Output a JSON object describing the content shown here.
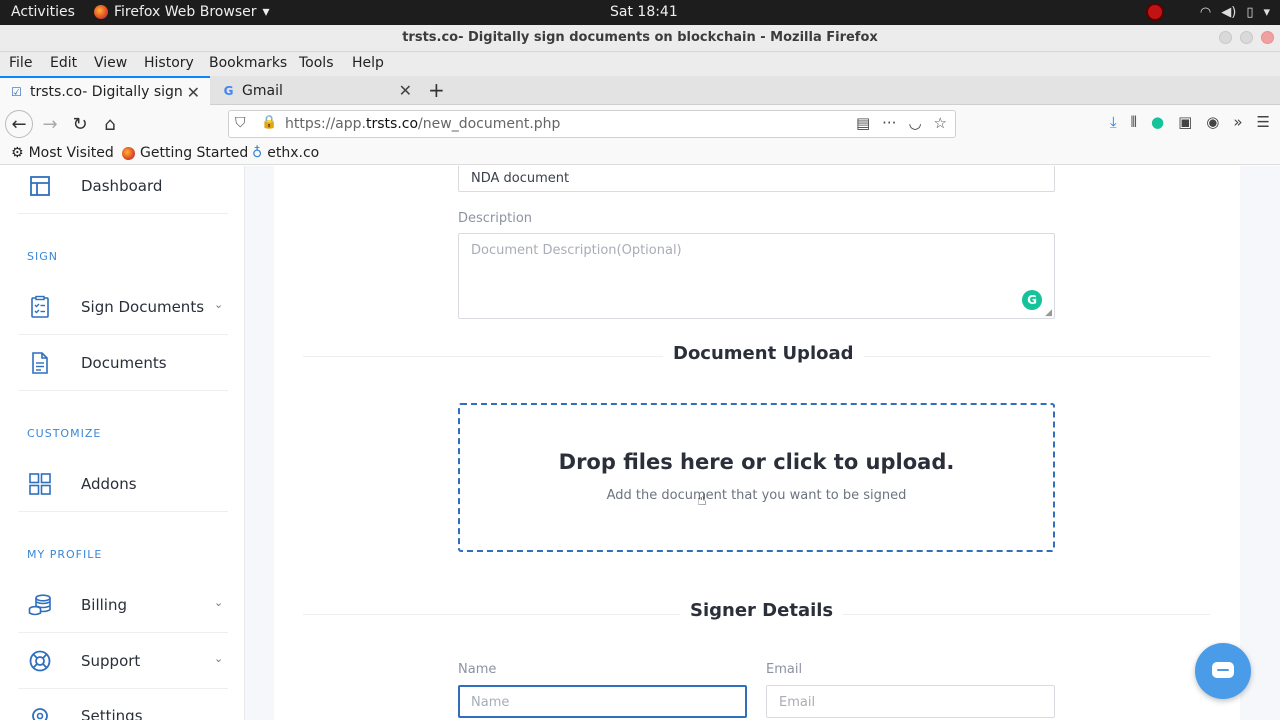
{
  "gnome": {
    "activities": "Activities",
    "app_menu": "Firefox Web Browser",
    "clock": "Sat 18:41"
  },
  "window": {
    "title": "trsts.co- Digitally sign documents on blockchain - Mozilla Firefox"
  },
  "menubar": {
    "items": [
      "File",
      "Edit",
      "View",
      "History",
      "Bookmarks",
      "Tools",
      "Help"
    ]
  },
  "tabs": [
    {
      "label": "trsts.co- Digitally sign do",
      "active": true
    },
    {
      "label": "Gmail",
      "active": false
    }
  ],
  "urlbar": {
    "prefix": "https://app.",
    "domain": "trsts.co",
    "path": "/new_document.php"
  },
  "bookmarks": [
    "Most Visited",
    "Getting Started",
    "ethx.co"
  ],
  "sidebar": {
    "dashboard": "Dashboard",
    "section_sign": "SIGN",
    "sign_documents": "Sign Documents",
    "documents": "Documents",
    "section_customize": "CUSTOMIZE",
    "addons": "Addons",
    "section_profile": "MY PROFILE",
    "billing": "Billing",
    "support": "Support",
    "settings": "Settings"
  },
  "form": {
    "title_value": "NDA document",
    "description_label": "Description",
    "description_placeholder": "Document Description(Optional)",
    "upload_heading": "Document Upload",
    "drop_text": "Drop files here or click to upload.",
    "drop_subtext": "Add the document that you want to be signed",
    "signer_heading": "Signer Details",
    "name_label": "Name",
    "name_placeholder": "Name",
    "email_label": "Email",
    "email_placeholder": "Email"
  },
  "colors": {
    "accent": "#2f6fbd",
    "firefox_tab": "#0a84ff",
    "grammarly": "#15c39a",
    "chat": "#4a9be8"
  }
}
